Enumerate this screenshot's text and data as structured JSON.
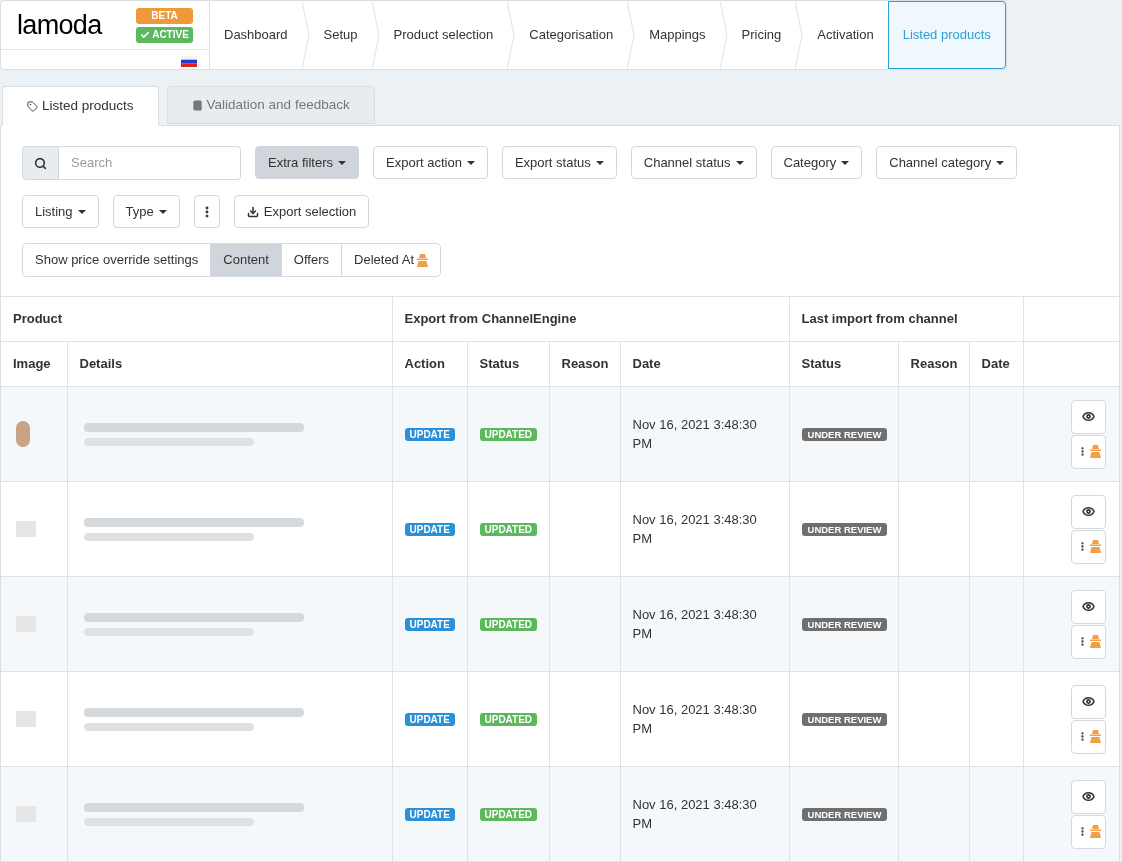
{
  "brand": {
    "logo": "lamoda",
    "badges": [
      {
        "label": "BETA",
        "kind": "beta"
      },
      {
        "label": "ACTIVE",
        "kind": "active"
      }
    ]
  },
  "steps": [
    {
      "label": "Dashboard",
      "selected": false
    },
    {
      "label": "Setup",
      "selected": false
    },
    {
      "label": "Product selection",
      "selected": false
    },
    {
      "label": "Categorisation",
      "selected": false
    },
    {
      "label": "Mappings",
      "selected": false
    },
    {
      "label": "Pricing",
      "selected": false
    },
    {
      "label": "Activation",
      "selected": false
    },
    {
      "label": "Listed products",
      "selected": true
    }
  ],
  "tabs": [
    {
      "label": "Listed products",
      "selected": true,
      "kind": "tag"
    },
    {
      "label": "Validation and feedback",
      "selected": false,
      "kind": "book"
    }
  ],
  "search": {
    "placeholder": "Search"
  },
  "filters": [
    {
      "label": "Extra filters",
      "kind": "dropdown",
      "selected": true
    },
    {
      "label": "Export action",
      "kind": "dropdown",
      "selected": false
    },
    {
      "label": "Export status",
      "kind": "dropdown",
      "selected": false
    },
    {
      "label": "Channel status",
      "kind": "dropdown",
      "selected": false
    },
    {
      "label": "Category",
      "kind": "dropdown",
      "selected": false
    },
    {
      "label": "Channel category",
      "kind": "dropdown",
      "selected": false
    },
    {
      "label": "Listing",
      "kind": "dropdown",
      "selected": false
    },
    {
      "label": "Type",
      "kind": "dropdown",
      "selected": false
    },
    {
      "kind": "more",
      "selected": false
    },
    {
      "label": "Export selection",
      "kind": "export",
      "selected": false
    }
  ],
  "toggles": [
    {
      "label": "Show price override settings",
      "selected": false,
      "spy": false
    },
    {
      "label": "Content",
      "selected": true,
      "spy": false
    },
    {
      "label": "Offers",
      "selected": false,
      "spy": false
    },
    {
      "label": "Deleted At",
      "selected": false,
      "spy": true
    }
  ],
  "table": {
    "groups": [
      "Product",
      "Export from ChannelEngine",
      "Last import from channel"
    ],
    "columns": [
      "Image",
      "Details",
      "Action",
      "Status",
      "Reason",
      "Date",
      "Status",
      "Reason",
      "Date"
    ],
    "rows": [
      {
        "kind": "photo",
        "action": "UPDATE",
        "status": "UPDATED",
        "date": "Nov 16, 2021 3:48:30 PM",
        "import_status": "UNDER REVIEW"
      },
      {
        "kind": "placeholder",
        "action": "UPDATE",
        "status": "UPDATED",
        "date": "Nov 16, 2021 3:48:30 PM",
        "import_status": "UNDER REVIEW"
      },
      {
        "kind": "placeholder",
        "action": "UPDATE",
        "status": "UPDATED",
        "date": "Nov 16, 2021 3:48:30 PM",
        "import_status": "UNDER REVIEW"
      },
      {
        "kind": "placeholder",
        "action": "UPDATE",
        "status": "UPDATED",
        "date": "Nov 16, 2021 3:48:30 PM",
        "import_status": "UNDER REVIEW"
      },
      {
        "kind": "placeholder",
        "action": "UPDATE",
        "status": "UPDATED",
        "date": "Nov 16, 2021 3:48:30 PM",
        "import_status": "UNDER REVIEW"
      }
    ]
  }
}
